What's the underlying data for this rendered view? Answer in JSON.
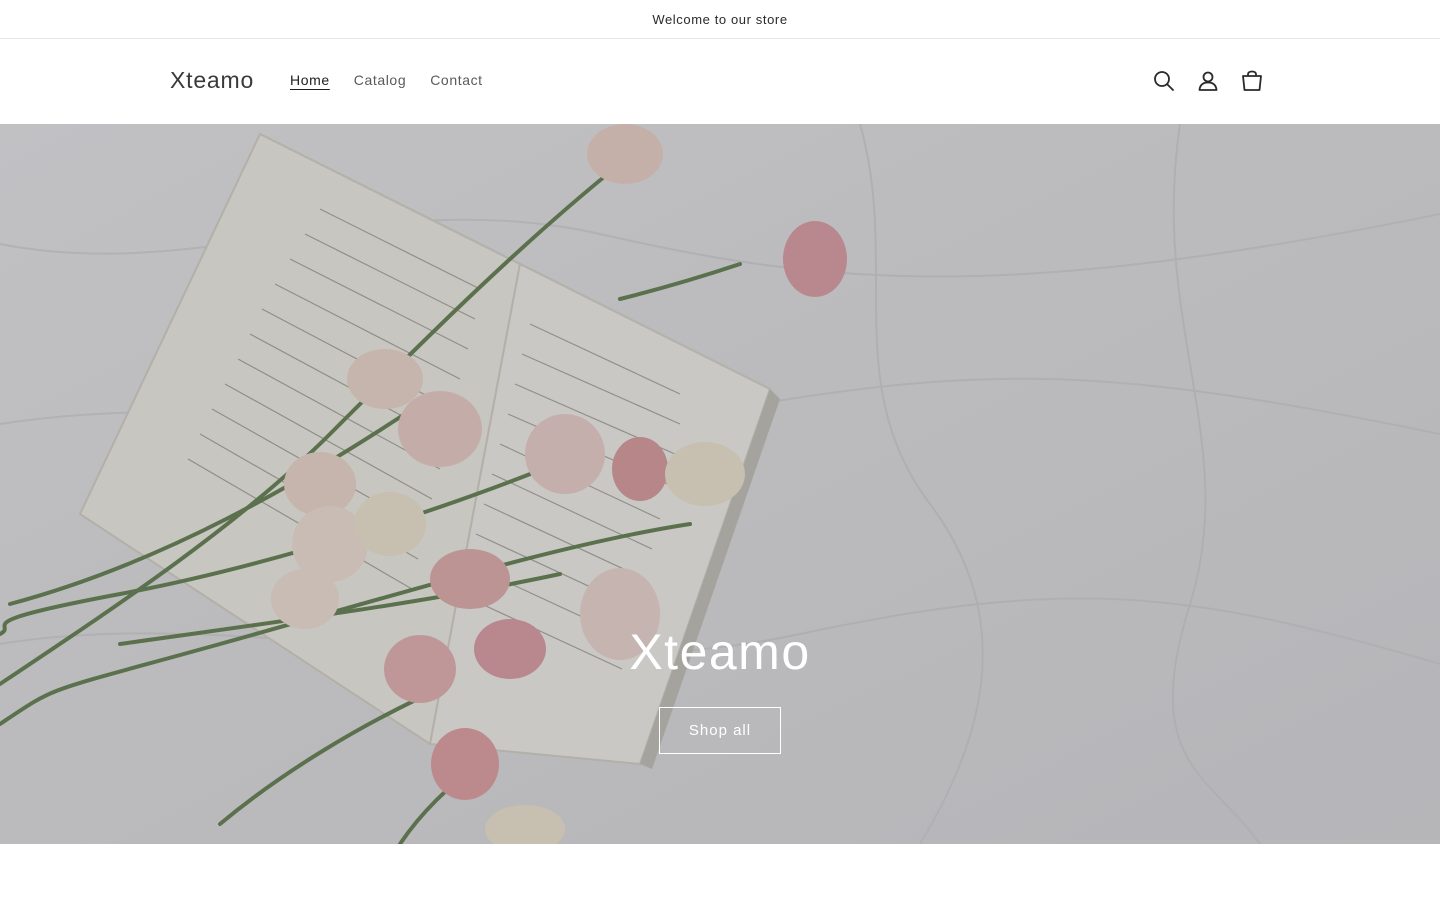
{
  "announcement": {
    "text": "Welcome to our store"
  },
  "header": {
    "logo": "Xteamo",
    "nav": [
      {
        "label": "Home",
        "active": true
      },
      {
        "label": "Catalog",
        "active": false
      },
      {
        "label": "Contact",
        "active": false
      }
    ],
    "icons": [
      "search-icon",
      "account-icon",
      "cart-icon"
    ]
  },
  "hero": {
    "title": "Xteamo",
    "button_label": "Shop all",
    "image_description_colors": {
      "background": "#e3e3e6",
      "page": "#f4f2ea",
      "stem": "#6f8a5e",
      "flower_pink": "#e2a7ae",
      "flower_cream": "#f3ead7"
    }
  }
}
